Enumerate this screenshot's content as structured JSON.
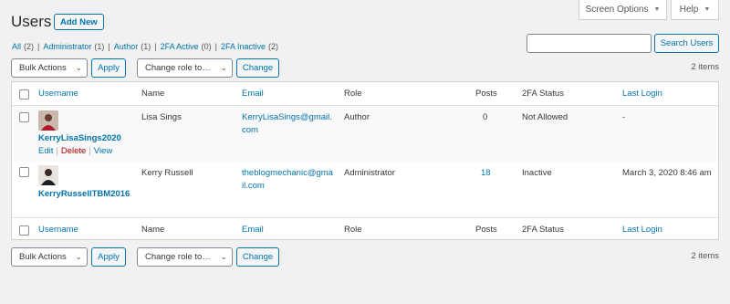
{
  "screen_meta": {
    "screen_options": "Screen Options",
    "help": "Help"
  },
  "header": {
    "title": "Users",
    "add_new": "Add New"
  },
  "filters": [
    {
      "label": "All",
      "count": "(2)"
    },
    {
      "label": "Administrator",
      "count": "(1)"
    },
    {
      "label": "Author",
      "count": "(1)"
    },
    {
      "label": "2FA Active",
      "count": "(0)"
    },
    {
      "label": "2FA Inactive",
      "count": "(2)"
    }
  ],
  "search": {
    "placeholder": "",
    "button": "Search Users"
  },
  "tablenav": {
    "bulk_actions": "Bulk Actions",
    "apply": "Apply",
    "change_role": "Change role to…",
    "change": "Change",
    "items": "2 items"
  },
  "columns": {
    "username": "Username",
    "name": "Name",
    "email": "Email",
    "role": "Role",
    "posts": "Posts",
    "twofa": "2FA Status",
    "last_login": "Last Login"
  },
  "users": [
    {
      "username": "KerryLisaSings2020",
      "name": "Lisa Sings",
      "email_line1": "KerryLisaSings@gmail.",
      "email_line2": "com",
      "role": "Author",
      "posts": "0",
      "twofa": "Not Allowed",
      "last_login": "-",
      "actions": {
        "edit": "Edit",
        "delete": "Delete",
        "view": "View"
      }
    },
    {
      "username": "KerryRussellTBM2016",
      "name": "Kerry Russell",
      "email_line1": "theblogmechanic@gma",
      "email_line2": "il.com",
      "role": "Administrator",
      "posts": "18",
      "twofa": "Inactive",
      "last_login": "March 3, 2020 8:46 am"
    }
  ],
  "colors": {
    "link": "#0073aa",
    "delete": "#aa0000",
    "border": "#ccd0d4",
    "background": "#f1f1f1"
  },
  "icons": {
    "caret": "caret-down-icon",
    "select_arrow": "chevron-down-icon"
  }
}
